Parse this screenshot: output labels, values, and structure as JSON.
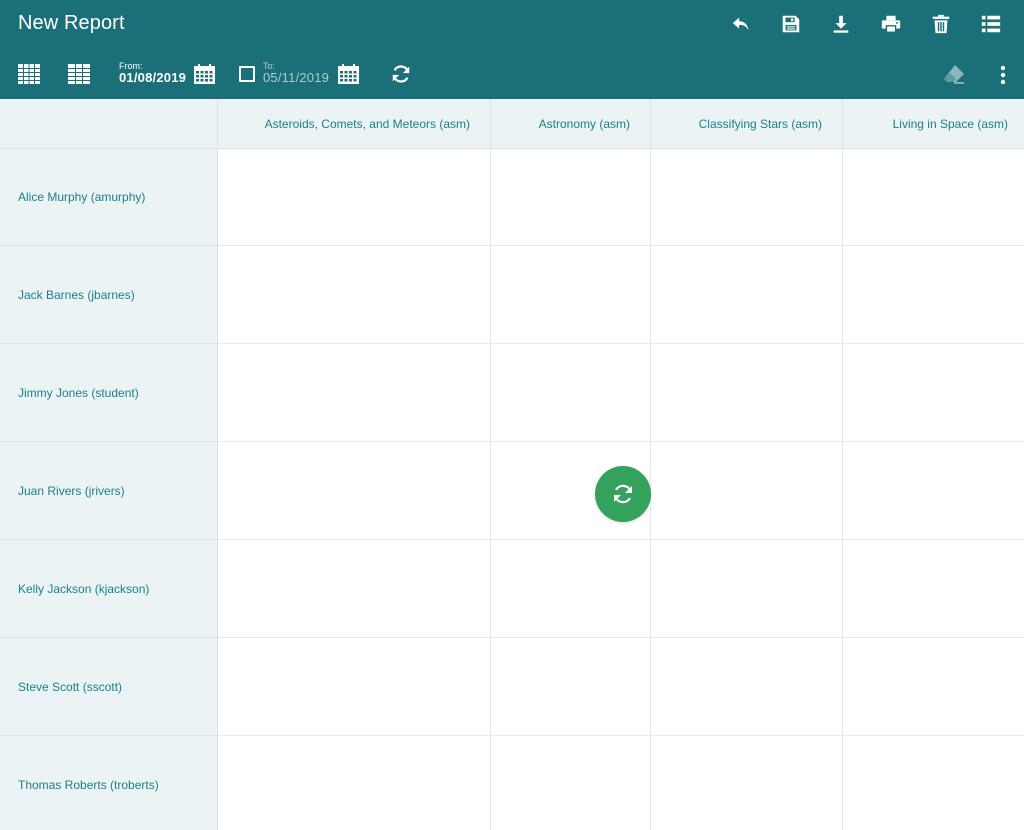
{
  "header": {
    "title": "New Report",
    "accent_color": "#1a6f78",
    "actions": [
      {
        "name": "undo-icon"
      },
      {
        "name": "save-icon"
      },
      {
        "name": "download-icon"
      },
      {
        "name": "print-icon"
      },
      {
        "name": "trash-icon"
      },
      {
        "name": "list-icon"
      }
    ]
  },
  "toolbar": {
    "from_label": "From:",
    "from_value": "01/08/2019",
    "to_label": "To:",
    "to_value": "05/11/2019",
    "to_enabled": false,
    "icons": [
      "grid-view-icon",
      "table-view-icon",
      "calendar-icon",
      "calendar-icon",
      "refresh-icon",
      "eraser-icon",
      "more-vertical-icon"
    ]
  },
  "table": {
    "columns": [
      "Asteroids, Comets, and Meteors (asm)",
      "Astronomy (asm)",
      "Classifying Stars (asm)",
      "Living in Space (asm)"
    ],
    "rows": [
      "Alice Murphy (amurphy)",
      "Jack Barnes (jbarnes)",
      "Jimmy Jones (student)",
      "Juan Rivers (jrivers)",
      "Kelly Jackson (kjackson)",
      "Steve Scott (sscott)",
      "Thomas Roberts (troberts)"
    ]
  },
  "fab": {
    "icon": "refresh-icon",
    "color": "#34a15d"
  }
}
